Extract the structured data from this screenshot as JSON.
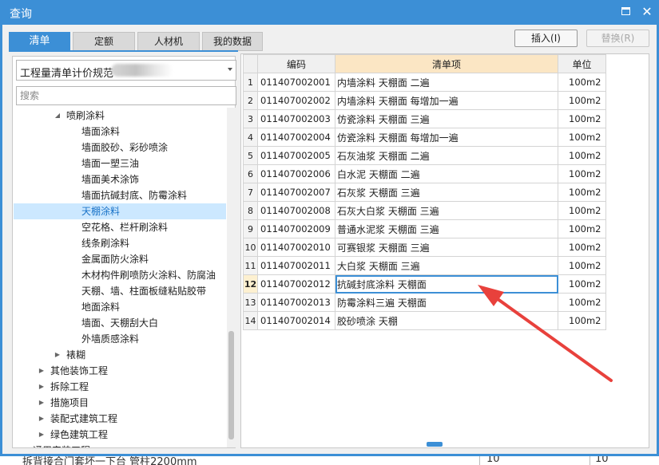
{
  "window": {
    "title": "查询"
  },
  "tabs": [
    "清单",
    "定额",
    "人材机",
    "我的数据"
  ],
  "buttons": {
    "insert": "插入(I)",
    "replace": "替换(R)"
  },
  "library": {
    "selected": "工程量清单计价规范"
  },
  "search": {
    "placeholder": "搜索"
  },
  "tree": [
    {
      "label": "喷刷涂料",
      "level": 2,
      "expander": "expanded"
    },
    {
      "label": "墙面涂料",
      "level": 3
    },
    {
      "label": "墙面胶砂、彩砂喷涂",
      "level": 3
    },
    {
      "label": "墙面一塑三油",
      "level": 3
    },
    {
      "label": "墙面美术涂饰",
      "level": 3
    },
    {
      "label": "墙面抗碱封底、防霉涂料",
      "level": 3
    },
    {
      "label": "天棚涂料",
      "level": 3,
      "selected": true
    },
    {
      "label": "空花格、栏杆刷涂料",
      "level": 3
    },
    {
      "label": "线条刷涂料",
      "level": 3
    },
    {
      "label": "金属面防火涂料",
      "level": 3
    },
    {
      "label": "木材构件刷喷防火涂料、防腐油",
      "level": 3
    },
    {
      "label": "天棚、墙、柱面板缝粘贴胶带",
      "level": 3
    },
    {
      "label": "地面涂料",
      "level": 3
    },
    {
      "label": "墙面、天棚刮大白",
      "level": 3
    },
    {
      "label": "外墙质感涂料",
      "level": 3
    },
    {
      "label": "裱糊",
      "level": 2,
      "expander": "collapsed"
    },
    {
      "label": "其他装饰工程",
      "level": 1,
      "expander": "collapsed"
    },
    {
      "label": "拆除工程",
      "level": 1,
      "expander": "collapsed"
    },
    {
      "label": "措施项目",
      "level": 1,
      "expander": "collapsed"
    },
    {
      "label": "装配式建筑工程",
      "level": 1,
      "expander": "collapsed"
    },
    {
      "label": "绿色建筑工程",
      "level": 1,
      "expander": "collapsed"
    },
    {
      "label": "通用安装工程",
      "level": 0,
      "expander": "collapsed"
    }
  ],
  "grid": {
    "headers": {
      "code": "编码",
      "item": "清单项",
      "unit": "单位"
    },
    "current_row": 12,
    "rows": [
      {
        "n": "1",
        "code": "011407002001",
        "item": "内墙涂料 天棚面 二遍",
        "unit": "100m2"
      },
      {
        "n": "2",
        "code": "011407002002",
        "item": "内墙涂料 天棚面 每增加一遍",
        "unit": "100m2"
      },
      {
        "n": "3",
        "code": "011407002003",
        "item": "仿瓷涂料 天棚面 三遍",
        "unit": "100m2"
      },
      {
        "n": "4",
        "code": "011407002004",
        "item": "仿瓷涂料 天棚面 每增加一遍",
        "unit": "100m2"
      },
      {
        "n": "5",
        "code": "011407002005",
        "item": "石灰油浆 天棚面 二遍",
        "unit": "100m2"
      },
      {
        "n": "6",
        "code": "011407002006",
        "item": "白水泥 天棚面 二遍",
        "unit": "100m2"
      },
      {
        "n": "7",
        "code": "011407002007",
        "item": "石灰浆 天棚面 三遍",
        "unit": "100m2"
      },
      {
        "n": "8",
        "code": "011407002008",
        "item": "石灰大白浆 天棚面 三遍",
        "unit": "100m2"
      },
      {
        "n": "9",
        "code": "011407002009",
        "item": "普通水泥浆 天棚面 三遍",
        "unit": "100m2"
      },
      {
        "n": "10",
        "code": "011407002010",
        "item": "可赛银浆 天棚面 三遍",
        "unit": "100m2"
      },
      {
        "n": "11",
        "code": "011407002011",
        "item": "大白浆 天棚面 三遍",
        "unit": "100m2"
      },
      {
        "n": "12",
        "code": "011407002012",
        "item": "抗碱封底涂料 天棚面",
        "unit": "100m2"
      },
      {
        "n": "13",
        "code": "011407002013",
        "item": "防霉涂料三遍 天棚面",
        "unit": "100m2"
      },
      {
        "n": "14",
        "code": "011407002014",
        "item": "胶砂喷涂 天棚",
        "unit": "100m2"
      }
    ]
  },
  "underlay": {
    "text": "拆背接合门套坏一下台 管柱2200mm",
    "values": [
      "10",
      "10"
    ]
  },
  "colors": {
    "accent": "#3c8fd6",
    "header_highlight": "#fbe6c4",
    "selection": "#cce8ff",
    "annotation_arrow": "#e8413c"
  },
  "icons": {
    "maximize": "maximize-icon",
    "close": "close-icon",
    "dropdown": "chevron-down-icon",
    "expand": "triangle-right-icon",
    "collapse": "triangle-down-icon"
  }
}
